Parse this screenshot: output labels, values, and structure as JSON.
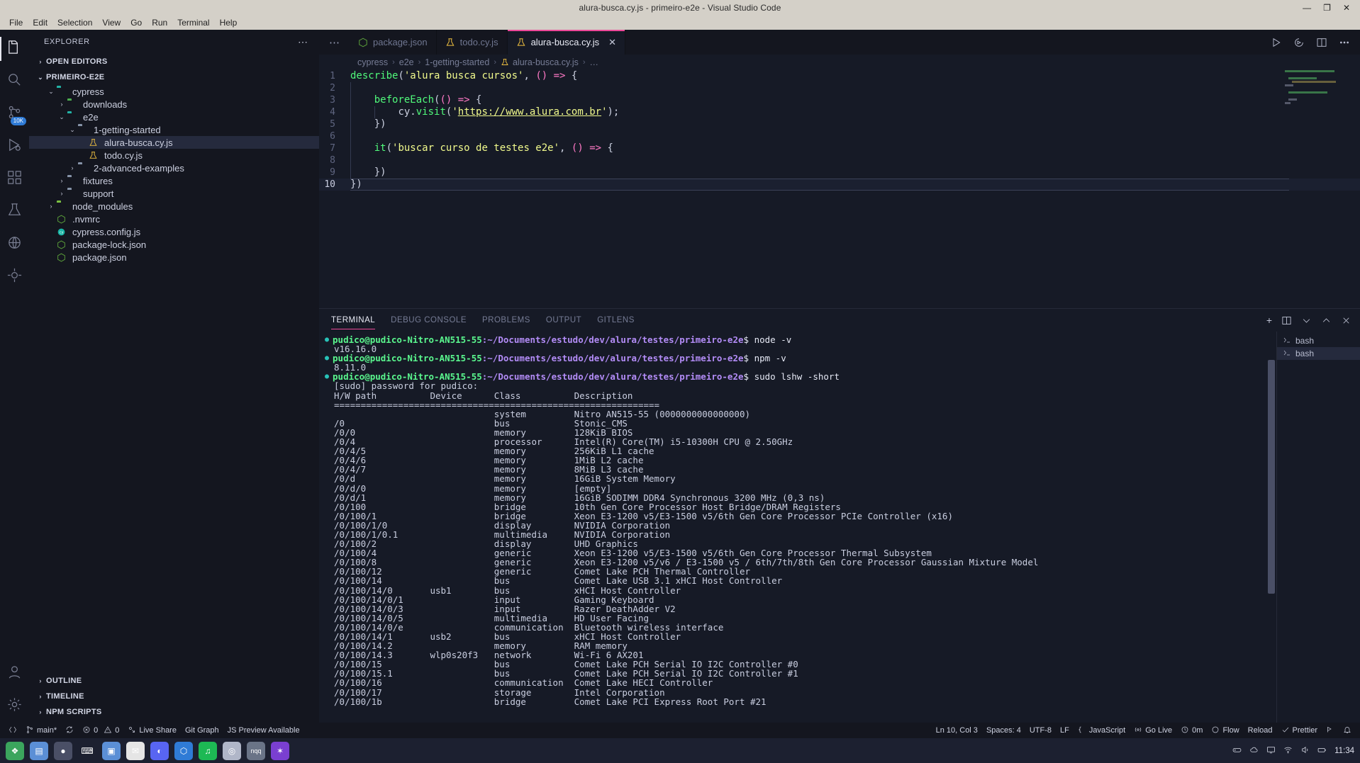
{
  "window": {
    "title": "alura-busca.cy.js - primeiro-e2e - Visual Studio Code",
    "minimize": "—",
    "maximize": "❐",
    "close": "✕"
  },
  "menubar": {
    "items": [
      "File",
      "Edit",
      "Selection",
      "View",
      "Go",
      "Run",
      "Terminal",
      "Help"
    ]
  },
  "activitybar": {
    "items": [
      {
        "name": "explorer",
        "badge": ""
      },
      {
        "name": "search",
        "badge": ""
      },
      {
        "name": "source-control",
        "badge": "10K"
      },
      {
        "name": "run-and-debug",
        "badge": ""
      },
      {
        "name": "extensions",
        "badge": ""
      },
      {
        "name": "testing",
        "badge": ""
      },
      {
        "name": "remote-explorer",
        "badge": ""
      },
      {
        "name": "gitlens",
        "badge": ""
      }
    ],
    "bottom": [
      {
        "name": "accounts"
      },
      {
        "name": "settings"
      }
    ]
  },
  "sidebar": {
    "title": "EXPLORER",
    "more": "⋯",
    "sections": [
      {
        "label": "OPEN EDITORS",
        "expanded": false
      },
      {
        "label": "PRIMEIRO-E2E",
        "expanded": true
      }
    ],
    "tree": [
      {
        "label": "cypress",
        "indent": 1,
        "type": "folder",
        "color": "f-teal",
        "arrow": "⌄",
        "selected": false
      },
      {
        "label": "downloads",
        "indent": 2,
        "type": "folder",
        "color": "f-green",
        "arrow": "›",
        "selected": false
      },
      {
        "label": "e2e",
        "indent": 2,
        "type": "folder",
        "color": "f-teal",
        "arrow": "⌄",
        "selected": false
      },
      {
        "label": "1-getting-started",
        "indent": 3,
        "type": "folder",
        "color": "f-gray",
        "arrow": "⌄",
        "selected": false
      },
      {
        "label": "alura-busca.cy.js",
        "indent": 4,
        "type": "flask",
        "color": "",
        "arrow": "",
        "selected": true
      },
      {
        "label": "todo.cy.js",
        "indent": 4,
        "type": "flask",
        "color": "",
        "arrow": "",
        "selected": false
      },
      {
        "label": "2-advanced-examples",
        "indent": 3,
        "type": "folder",
        "color": "f-gray",
        "arrow": "›",
        "selected": false
      },
      {
        "label": "fixtures",
        "indent": 2,
        "type": "folder",
        "color": "f-gray",
        "arrow": "›",
        "selected": false
      },
      {
        "label": "support",
        "indent": 2,
        "type": "folder",
        "color": "f-gray",
        "arrow": "›",
        "selected": false
      },
      {
        "label": "node_modules",
        "indent": 1,
        "type": "folder",
        "color": "f-lgreen",
        "arrow": "›",
        "selected": false
      },
      {
        "label": ".nvmrc",
        "indent": 1,
        "type": "node",
        "color": "",
        "arrow": "",
        "selected": false
      },
      {
        "label": "cypress.config.js",
        "indent": 1,
        "type": "cy",
        "color": "",
        "arrow": "",
        "selected": false
      },
      {
        "label": "package-lock.json",
        "indent": 1,
        "type": "node",
        "color": "",
        "arrow": "",
        "selected": false
      },
      {
        "label": "package.json",
        "indent": 1,
        "type": "node",
        "color": "",
        "arrow": "",
        "selected": false
      }
    ],
    "bottom_sections": [
      {
        "label": "OUTLINE"
      },
      {
        "label": "TIMELINE"
      },
      {
        "label": "NPM SCRIPTS"
      }
    ]
  },
  "tabs": {
    "more": "⋯",
    "items": [
      {
        "label": "package.json",
        "icon": "node-icon",
        "active": false,
        "closable": false
      },
      {
        "label": "todo.cy.js",
        "icon": "flask-icon",
        "active": false,
        "closable": false
      },
      {
        "label": "alura-busca.cy.js",
        "icon": "flask-icon",
        "active": true,
        "closable": true,
        "close": "✕"
      }
    ],
    "actions": [
      "run-icon",
      "run-debug-icon",
      "split-editor-icon",
      "more-actions-icon"
    ]
  },
  "breadcrumb": {
    "sep": "›",
    "items": [
      "cypress",
      "e2e",
      "1-getting-started",
      "alura-busca.cy.js",
      "…"
    ]
  },
  "editor": {
    "lines": [
      {
        "n": 1,
        "tokens": [
          {
            "t": "describe",
            "c": "fn"
          },
          {
            "t": "(",
            "c": "pun"
          },
          {
            "t": "'alura busca cursos'",
            "c": "str"
          },
          {
            "t": ", ",
            "c": "pun"
          },
          {
            "t": "()",
            "c": "par"
          },
          {
            "t": " ",
            "c": "pun"
          },
          {
            "t": "=>",
            "c": "kw"
          },
          {
            "t": " ",
            "c": "pun"
          },
          {
            "t": "{",
            "c": "pun"
          }
        ]
      },
      {
        "n": 2,
        "tokens": []
      },
      {
        "n": 3,
        "tokens": [
          {
            "t": "    ",
            "c": "pun"
          },
          {
            "t": "beforeEach",
            "c": "fn"
          },
          {
            "t": "(",
            "c": "pun"
          },
          {
            "t": "()",
            "c": "par"
          },
          {
            "t": " ",
            "c": "pun"
          },
          {
            "t": "=>",
            "c": "kw"
          },
          {
            "t": " ",
            "c": "pun"
          },
          {
            "t": "{",
            "c": "pun"
          }
        ]
      },
      {
        "n": 4,
        "tokens": [
          {
            "t": "        ",
            "c": "pun"
          },
          {
            "t": "cy",
            "c": "pun"
          },
          {
            "t": ".",
            "c": "pun"
          },
          {
            "t": "visit",
            "c": "fn"
          },
          {
            "t": "(",
            "c": "pun"
          },
          {
            "t": "'",
            "c": "str"
          },
          {
            "t": "https://www.alura.com.br",
            "c": "lnk"
          },
          {
            "t": "'",
            "c": "str"
          },
          {
            "t": ");",
            "c": "pun"
          }
        ]
      },
      {
        "n": 5,
        "tokens": [
          {
            "t": "    ",
            "c": "pun"
          },
          {
            "t": "})",
            "c": "pun"
          }
        ]
      },
      {
        "n": 6,
        "tokens": []
      },
      {
        "n": 7,
        "tokens": [
          {
            "t": "    ",
            "c": "pun"
          },
          {
            "t": "it",
            "c": "fn"
          },
          {
            "t": "(",
            "c": "pun"
          },
          {
            "t": "'buscar curso de testes e2e'",
            "c": "str"
          },
          {
            "t": ", ",
            "c": "pun"
          },
          {
            "t": "()",
            "c": "par"
          },
          {
            "t": " ",
            "c": "pun"
          },
          {
            "t": "=>",
            "c": "kw"
          },
          {
            "t": " ",
            "c": "pun"
          },
          {
            "t": "{",
            "c": "pun"
          }
        ]
      },
      {
        "n": 8,
        "tokens": []
      },
      {
        "n": 9,
        "tokens": [
          {
            "t": "    ",
            "c": "pun"
          },
          {
            "t": "})",
            "c": "pun"
          }
        ]
      },
      {
        "n": 10,
        "tokens": [
          {
            "t": "})",
            "c": "pun"
          }
        ],
        "current": true
      }
    ]
  },
  "panel": {
    "tabs": [
      "TERMINAL",
      "DEBUG CONSOLE",
      "PROBLEMS",
      "OUTPUT",
      "GITLENS"
    ],
    "active_tab": "TERMINAL",
    "actions": [
      "new-terminal-icon",
      "split-terminal-icon",
      "chevron-down-icon",
      "maximize-panel-icon",
      "close-panel-icon"
    ],
    "new_terminal": "+",
    "terminals": [
      {
        "label": "bash",
        "selected": false
      },
      {
        "label": "bash",
        "selected": true
      }
    ]
  },
  "terminal": {
    "user": "pudico@pudico-Nitro-AN515-55",
    "path": ":~/Documents/estudo/dev/alura/testes/primeiro-e2e",
    "lines": [
      {
        "type": "prompt",
        "cmd": "$ node -v"
      },
      {
        "type": "out",
        "text": "v16.16.0"
      },
      {
        "type": "prompt",
        "cmd": "$ npm -v"
      },
      {
        "type": "out",
        "text": "8.11.0"
      },
      {
        "type": "prompt",
        "cmd": "$ sudo lshw -short"
      },
      {
        "type": "out",
        "text": "[sudo] password for pudico:"
      },
      {
        "type": "out",
        "text": "H/W path          Device      Class          Description"
      },
      {
        "type": "out",
        "text": "============================================================="
      },
      {
        "type": "out",
        "text": "                              system         Nitro AN515-55 (0000000000000000)"
      },
      {
        "type": "out",
        "text": "/0                            bus            Stonic_CMS"
      },
      {
        "type": "out",
        "text": "/0/0                          memory         128KiB BIOS"
      },
      {
        "type": "out",
        "text": "/0/4                          processor      Intel(R) Core(TM) i5-10300H CPU @ 2.50GHz"
      },
      {
        "type": "out",
        "text": "/0/4/5                        memory         256KiB L1 cache"
      },
      {
        "type": "out",
        "text": "/0/4/6                        memory         1MiB L2 cache"
      },
      {
        "type": "out",
        "text": "/0/4/7                        memory         8MiB L3 cache"
      },
      {
        "type": "out",
        "text": "/0/d                          memory         16GiB System Memory"
      },
      {
        "type": "out",
        "text": "/0/d/0                        memory         [empty]"
      },
      {
        "type": "out",
        "text": "/0/d/1                        memory         16GiB SODIMM DDR4 Synchronous 3200 MHz (0,3 ns)"
      },
      {
        "type": "out",
        "text": "/0/100                        bridge         10th Gen Core Processor Host Bridge/DRAM Registers"
      },
      {
        "type": "out",
        "text": "/0/100/1                      bridge         Xeon E3-1200 v5/E3-1500 v5/6th Gen Core Processor PCIe Controller (x16)"
      },
      {
        "type": "out",
        "text": "/0/100/1/0                    display        NVIDIA Corporation"
      },
      {
        "type": "out",
        "text": "/0/100/1/0.1                  multimedia     NVIDIA Corporation"
      },
      {
        "type": "out",
        "text": "/0/100/2                      display        UHD Graphics"
      },
      {
        "type": "out",
        "text": "/0/100/4                      generic        Xeon E3-1200 v5/E3-1500 v5/6th Gen Core Processor Thermal Subsystem"
      },
      {
        "type": "out",
        "text": "/0/100/8                      generic        Xeon E3-1200 v5/v6 / E3-1500 v5 / 6th/7th/8th Gen Core Processor Gaussian Mixture Model"
      },
      {
        "type": "out",
        "text": "/0/100/12                     generic        Comet Lake PCH Thermal Controller"
      },
      {
        "type": "out",
        "text": "/0/100/14                     bus            Comet Lake USB 3.1 xHCI Host Controller"
      },
      {
        "type": "out",
        "text": "/0/100/14/0       usb1        bus            xHCI Host Controller"
      },
      {
        "type": "out",
        "text": "/0/100/14/0/1                 input          Gaming Keyboard"
      },
      {
        "type": "out",
        "text": "/0/100/14/0/3                 input          Razer DeathAdder V2"
      },
      {
        "type": "out",
        "text": "/0/100/14/0/5                 multimedia     HD User Facing"
      },
      {
        "type": "out",
        "text": "/0/100/14/0/e                 communication  Bluetooth wireless interface"
      },
      {
        "type": "out",
        "text": "/0/100/14/1       usb2        bus            xHCI Host Controller"
      },
      {
        "type": "out",
        "text": "/0/100/14.2                   memory         RAM memory"
      },
      {
        "type": "out",
        "text": "/0/100/14.3       wlp0s20f3   network        Wi-Fi 6 AX201"
      },
      {
        "type": "out",
        "text": "/0/100/15                     bus            Comet Lake PCH Serial IO I2C Controller #0"
      },
      {
        "type": "out",
        "text": "/0/100/15.1                   bus            Comet Lake PCH Serial IO I2C Controller #1"
      },
      {
        "type": "out",
        "text": "/0/100/16                     communication  Comet Lake HECI Controller"
      },
      {
        "type": "out",
        "text": "/0/100/17                     storage        Intel Corporation"
      },
      {
        "type": "out",
        "text": "/0/100/1b                     bridge         Comet Lake PCI Express Root Port #21"
      }
    ]
  },
  "statusbar": {
    "left": [
      {
        "icon": "remote-icon",
        "label": ""
      },
      {
        "icon": "branch-icon",
        "label": "main*"
      },
      {
        "icon": "sync-icon",
        "label": ""
      },
      {
        "icon": "error-icon",
        "label": "0"
      },
      {
        "icon": "warning-icon",
        "label": "0"
      },
      {
        "icon": "live-share-icon",
        "label": "Live Share"
      },
      {
        "icon": "",
        "label": "Git Graph"
      },
      {
        "icon": "",
        "label": "JS Preview Available"
      }
    ],
    "right": [
      {
        "icon": "",
        "label": "Ln 10, Col 3"
      },
      {
        "icon": "",
        "label": "Spaces: 4"
      },
      {
        "icon": "",
        "label": "UTF-8"
      },
      {
        "icon": "",
        "label": "LF"
      },
      {
        "icon": "braces-icon",
        "label": "JavaScript"
      },
      {
        "icon": "broadcast-icon",
        "label": "Go Live"
      },
      {
        "icon": "clock-icon",
        "label": "0m"
      },
      {
        "icon": "circle-icon",
        "label": "Flow"
      },
      {
        "icon": "",
        "label": "Reload"
      },
      {
        "icon": "check-icon",
        "label": "Prettier"
      },
      {
        "icon": "feedback-icon",
        "label": ""
      },
      {
        "icon": "bell-icon",
        "label": ""
      }
    ]
  },
  "taskbar": {
    "apps": [
      {
        "name": "start-menu",
        "glyph": "❖",
        "color": "#3ba55d"
      },
      {
        "name": "files",
        "glyph": "▤",
        "color": "#5b8fd6"
      },
      {
        "name": "browser",
        "glyph": "●",
        "color": "#4a4f66"
      },
      {
        "name": "terminal",
        "glyph": "⌨",
        "color": "#1c2030"
      },
      {
        "name": "file-manager",
        "glyph": "▣",
        "color": "#5b8fd6"
      },
      {
        "name": "mail",
        "glyph": "✉",
        "color": "#e5e5e5"
      },
      {
        "name": "discord",
        "glyph": "◐",
        "color": "#5865f2"
      },
      {
        "name": "vscode",
        "glyph": "⬡",
        "color": "#2f7bd6"
      },
      {
        "name": "spotify",
        "glyph": "♫",
        "color": "#1db954"
      },
      {
        "name": "obs",
        "glyph": "◎",
        "color": "#b0b6c8"
      },
      {
        "name": "nqq",
        "glyph": "nqq",
        "color": "#6a7487"
      },
      {
        "name": "insomnia",
        "glyph": "✶",
        "color": "#7a3fd1"
      }
    ],
    "tray": [
      {
        "name": "game-controller-icon",
        "label": ""
      },
      {
        "name": "cloud-icon",
        "label": ""
      },
      {
        "name": "screen-icon",
        "label": ""
      },
      {
        "name": "network-icon",
        "label": ""
      },
      {
        "name": "volume-icon",
        "label": ""
      },
      {
        "name": "battery-icon",
        "label": ""
      }
    ],
    "clock": "11:34"
  }
}
